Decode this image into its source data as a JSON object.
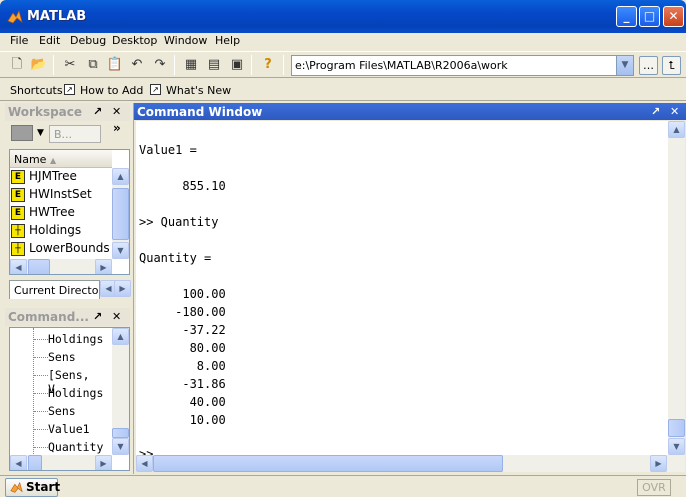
{
  "window": {
    "title": "MATLAB"
  },
  "menu": [
    "File",
    "Edit",
    "Debug",
    "Desktop",
    "Window",
    "Help"
  ],
  "toolbar": {
    "current_dir": "e:\\Program Files\\MATLAB\\R2006a\\work"
  },
  "shortcuts": {
    "label": "Shortcuts",
    "how_to_add": "How to Add",
    "whats_new": "What's New"
  },
  "workspace": {
    "title": "Workspace",
    "column_header": "Name",
    "items": [
      {
        "name": "HJMTree",
        "icon": "E"
      },
      {
        "name": "HWInstSet",
        "icon": "E"
      },
      {
        "name": "HWTree",
        "icon": "E"
      },
      {
        "name": "Holdings",
        "icon": "grid"
      },
      {
        "name": "LowerBounds",
        "icon": "grid"
      }
    ],
    "tab_label": "Current Directory"
  },
  "history": {
    "title": "Command...",
    "items": [
      "Holdings",
      "Sens",
      "[Sens, V",
      "Holdings",
      "Sens",
      "Value1",
      "Quantity"
    ]
  },
  "command_window": {
    "title": "Command Window",
    "lines": [
      "Value1 =",
      "",
      "      855.10",
      "",
      ">> Quantity",
      "",
      "Quantity =",
      "",
      "      100.00",
      "     -180.00",
      "      -37.22",
      "       80.00",
      "        8.00",
      "      -31.86",
      "       40.00",
      "       10.00",
      "",
      ">>"
    ]
  },
  "status": {
    "start_label": "Start",
    "ovr": "OVR"
  }
}
